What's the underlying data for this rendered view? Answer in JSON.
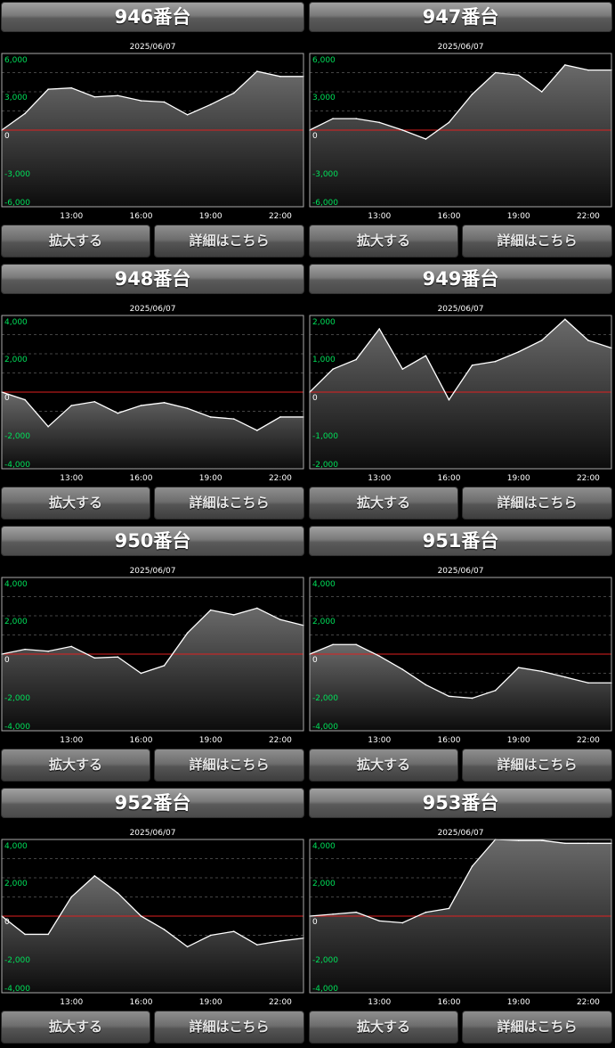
{
  "buttons": {
    "expand_label": "拡大する",
    "detail_label": "詳細はこちら"
  },
  "colors": {
    "zero_line": "#e02020",
    "tick_label": "#00e05a",
    "data_line": "#ffffff"
  },
  "chart_data": [
    {
      "type": "area",
      "title": "946番台",
      "date": "2025/06/07",
      "ylim": [
        -6000,
        6000
      ],
      "y_ticks": [
        "6,000",
        "3,000",
        "0",
        "-3,000",
        "-6,000"
      ],
      "y_tick_values": [
        6000,
        3000,
        0,
        -3000,
        -6000
      ],
      "x_ticks": [
        "13:00",
        "16:00",
        "19:00",
        "22:00"
      ],
      "x_tick_values": [
        13,
        16,
        19,
        22
      ],
      "xlim": [
        10,
        23
      ],
      "x": [
        10,
        11,
        12,
        13,
        14,
        15,
        16,
        17,
        18,
        19,
        20,
        21,
        22,
        23
      ],
      "values": [
        0,
        1300,
        3200,
        3300,
        2600,
        2700,
        2300,
        2200,
        1200,
        2000,
        2900,
        4600,
        4200,
        4200
      ],
      "grid": true
    },
    {
      "type": "area",
      "title": "947番台",
      "date": "2025/06/07",
      "ylim": [
        -6000,
        6000
      ],
      "y_ticks": [
        "6,000",
        "3,000",
        "0",
        "-3,000",
        "-6,000"
      ],
      "y_tick_values": [
        6000,
        3000,
        0,
        -3000,
        -6000
      ],
      "x_ticks": [
        "13:00",
        "16:00",
        "19:00",
        "22:00"
      ],
      "x_tick_values": [
        13,
        16,
        19,
        22
      ],
      "xlim": [
        10,
        23
      ],
      "x": [
        10,
        11,
        12,
        13,
        14,
        15,
        16,
        17,
        18,
        19,
        20,
        21,
        22,
        23
      ],
      "values": [
        0,
        900,
        900,
        600,
        0,
        -700,
        600,
        2800,
        4500,
        4300,
        3000,
        5100,
        4700,
        4700
      ],
      "grid": true
    },
    {
      "type": "area",
      "title": "948番台",
      "date": "2025/06/07",
      "ylim": [
        -4000,
        4000
      ],
      "y_ticks": [
        "4,000",
        "2,000",
        "0",
        "-2,000",
        "-4,000"
      ],
      "y_tick_values": [
        4000,
        2000,
        0,
        -2000,
        -4000
      ],
      "x_ticks": [
        "13:00",
        "16:00",
        "19:00",
        "22:00"
      ],
      "x_tick_values": [
        13,
        16,
        19,
        22
      ],
      "xlim": [
        10,
        23
      ],
      "x": [
        10,
        11,
        12,
        13,
        14,
        15,
        16,
        17,
        18,
        19,
        20,
        21,
        22,
        23
      ],
      "values": [
        0,
        -400,
        -1800,
        -700,
        -500,
        -1100,
        -700,
        -550,
        -850,
        -1300,
        -1400,
        -2000,
        -1300,
        -1300
      ],
      "grid": true
    },
    {
      "type": "area",
      "title": "949番台",
      "date": "2025/06/07",
      "ylim": [
        -2000,
        2000
      ],
      "y_ticks": [
        "2,000",
        "1,000",
        "0",
        "-1,000",
        "-2,000"
      ],
      "y_tick_values": [
        2000,
        1000,
        0,
        -1000,
        -2000
      ],
      "x_ticks": [
        "13:00",
        "16:00",
        "19:00",
        "22:00"
      ],
      "x_tick_values": [
        13,
        16,
        19,
        22
      ],
      "xlim": [
        10,
        23
      ],
      "x": [
        10,
        11,
        12,
        13,
        14,
        15,
        16,
        17,
        18,
        19,
        20,
        21,
        22,
        23
      ],
      "values": [
        0,
        600,
        850,
        1650,
        600,
        950,
        -200,
        700,
        800,
        1050,
        1350,
        1900,
        1350,
        1150
      ],
      "grid": true
    },
    {
      "type": "area",
      "title": "950番台",
      "date": "2025/06/07",
      "ylim": [
        -4000,
        4000
      ],
      "y_ticks": [
        "4,000",
        "2,000",
        "0",
        "-2,000",
        "-4,000"
      ],
      "y_tick_values": [
        4000,
        2000,
        0,
        -2000,
        -4000
      ],
      "x_ticks": [
        "13:00",
        "16:00",
        "19:00",
        "22:00"
      ],
      "x_tick_values": [
        13,
        16,
        19,
        22
      ],
      "xlim": [
        10,
        23
      ],
      "x": [
        10,
        11,
        12,
        13,
        14,
        15,
        16,
        17,
        18,
        19,
        20,
        21,
        22,
        23
      ],
      "values": [
        0,
        250,
        150,
        400,
        -200,
        -150,
        -1000,
        -600,
        1100,
        2300,
        2050,
        2400,
        1800,
        1500
      ],
      "grid": true
    },
    {
      "type": "area",
      "title": "951番台",
      "date": "2025/06/07",
      "ylim": [
        -4000,
        4000
      ],
      "y_ticks": [
        "4,000",
        "2,000",
        "0",
        "-2,000",
        "-4,000"
      ],
      "y_tick_values": [
        4000,
        2000,
        0,
        -2000,
        -4000
      ],
      "x_ticks": [
        "13:00",
        "16:00",
        "19:00",
        "22:00"
      ],
      "x_tick_values": [
        13,
        16,
        19,
        22
      ],
      "xlim": [
        10,
        23
      ],
      "x": [
        10,
        11,
        12,
        13,
        14,
        15,
        16,
        17,
        18,
        19,
        20,
        21,
        22,
        23
      ],
      "values": [
        0,
        500,
        500,
        -100,
        -800,
        -1600,
        -2200,
        -2300,
        -1900,
        -700,
        -900,
        -1200,
        -1500,
        -1500
      ],
      "grid": true
    },
    {
      "type": "area",
      "title": "952番台",
      "date": "2025/06/07",
      "ylim": [
        -4000,
        4000
      ],
      "y_ticks": [
        "4,000",
        "2,000",
        "0",
        "-2,000",
        "-4,000"
      ],
      "y_tick_values": [
        4000,
        2000,
        0,
        -2000,
        -4000
      ],
      "x_ticks": [
        "13:00",
        "16:00",
        "19:00",
        "22:00"
      ],
      "x_tick_values": [
        13,
        16,
        19,
        22
      ],
      "xlim": [
        10,
        23
      ],
      "x": [
        10,
        11,
        12,
        13,
        14,
        15,
        16,
        17,
        18,
        19,
        20,
        21,
        22,
        23
      ],
      "values": [
        0,
        -950,
        -950,
        1000,
        2100,
        1200,
        0,
        -700,
        -1600,
        -1000,
        -800,
        -1500,
        -1300,
        -1150
      ],
      "grid": true
    },
    {
      "type": "area",
      "title": "953番台",
      "date": "2025/06/07",
      "ylim": [
        -4000,
        4000
      ],
      "y_ticks": [
        "4,000",
        "2,000",
        "0",
        "-2,000",
        "-4,000"
      ],
      "y_tick_values": [
        4000,
        2000,
        0,
        -2000,
        -4000
      ],
      "x_ticks": [
        "13:00",
        "16:00",
        "19:00",
        "22:00"
      ],
      "x_tick_values": [
        13,
        16,
        19,
        22
      ],
      "xlim": [
        10,
        23
      ],
      "x": [
        10,
        11,
        12,
        13,
        14,
        15,
        16,
        17,
        18,
        19,
        20,
        21,
        22,
        23
      ],
      "values": [
        0,
        100,
        200,
        -250,
        -350,
        200,
        400,
        2600,
        4000,
        3950,
        3950,
        3800,
        3800,
        3800
      ],
      "grid": true
    }
  ]
}
